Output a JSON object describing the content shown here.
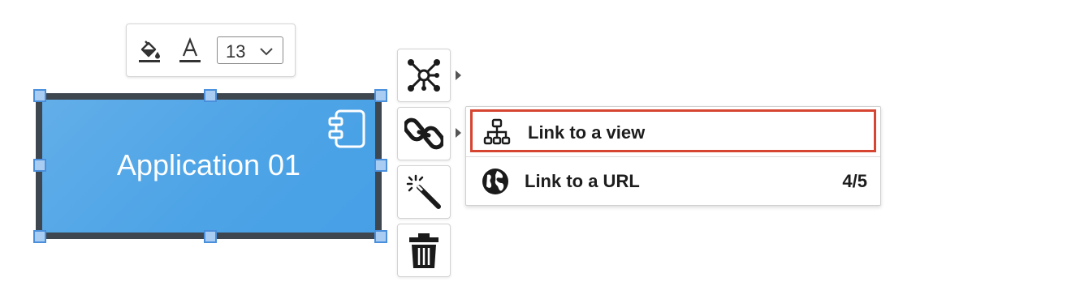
{
  "format_toolbar": {
    "fill_icon": "paint-bucket-icon",
    "text_color_icon": "text-color-icon",
    "font_size": "13"
  },
  "element": {
    "label": "Application 01",
    "type_icon": "component-icon",
    "fill_color": "#4da4e6",
    "border_color": "#3e4650"
  },
  "actions": [
    {
      "name": "relations",
      "icon": "network-icon"
    },
    {
      "name": "link",
      "icon": "chain-link-icon"
    },
    {
      "name": "magic",
      "icon": "magic-wand-icon"
    },
    {
      "name": "delete",
      "icon": "trash-icon"
    }
  ],
  "link_menu": {
    "items": [
      {
        "label": "Link to a view",
        "icon": "sitemap-icon",
        "highlighted": true,
        "count": ""
      },
      {
        "label": "Link to a URL",
        "icon": "globe-icon",
        "highlighted": false,
        "count": "4/5"
      }
    ],
    "highlight_color": "#d64531"
  }
}
